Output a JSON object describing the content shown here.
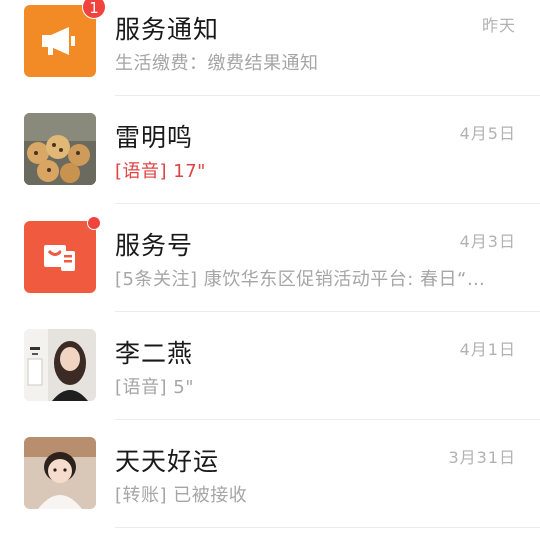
{
  "conversations": [
    {
      "name": "服务通知",
      "preview": "生活缴费：缴费结果通知",
      "time": "昨天",
      "badge": "1",
      "avatar_icon": "megaphone-icon",
      "avatar_color": "#f28a25"
    },
    {
      "name": "雷明鸣",
      "preview": "[语音] 17\"",
      "time": "4月5日",
      "avatar_icon": "photo-cookies"
    },
    {
      "name": "服务号",
      "preview": "[5条关注] 康饮华东区促销活动平台: 春日“…",
      "time": "4月3日",
      "avatar_icon": "shopping-bag-icon",
      "avatar_color": "#f05a3f",
      "unread_dot": true
    },
    {
      "name": "李二燕",
      "preview": "[语音] 5\"",
      "time": "4月1日",
      "avatar_icon": "photo-woman"
    },
    {
      "name": "天天好运",
      "preview": "[转账] 已被接收",
      "time": "3月31日",
      "avatar_icon": "photo-child"
    }
  ],
  "accent_red": "#f0433d"
}
